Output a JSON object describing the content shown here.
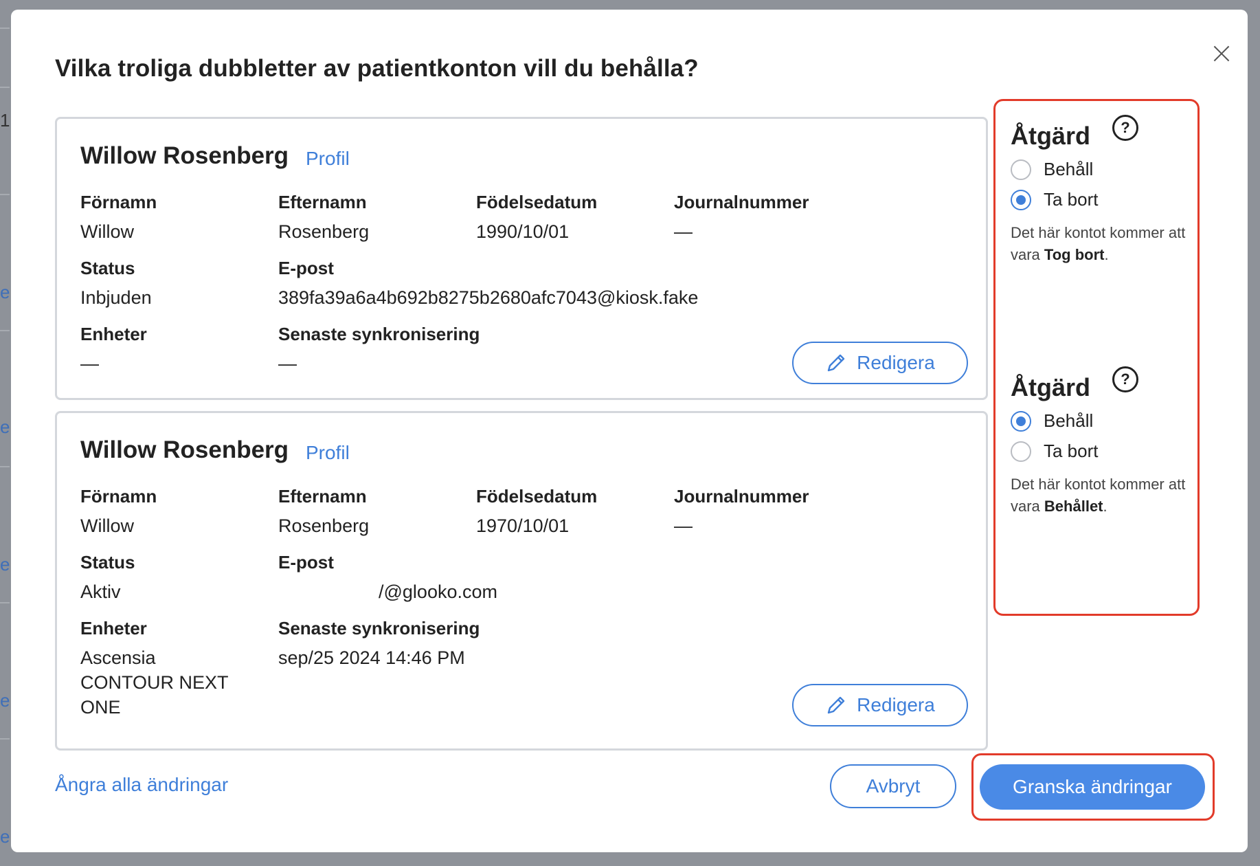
{
  "background": {
    "glyph_1": "1",
    "glyph_2": "e"
  },
  "modal": {
    "title": "Vilka troliga dubbletter av patientkonton vill du behålla?",
    "close_label": "×"
  },
  "labels": {
    "first_name": "Förnamn",
    "last_name": "Efternamn",
    "birth_date": "Födelsedatum",
    "record_number": "Journalnummer",
    "status": "Status",
    "email": "E-post",
    "devices": "Enheter",
    "last_sync": "Senaste synkronisering",
    "profile_link": "Profil",
    "edit_button": "Redigera"
  },
  "accounts": [
    {
      "name": "Willow Rosenberg",
      "first_name": "Willow",
      "last_name": "Rosenberg",
      "birth_date": "1990/10/01",
      "record_number": "—",
      "status": "Inbjuden",
      "email": "389fa39a6a4b692b8275b2680afc7043@kiosk.fake",
      "devices": [
        "—"
      ],
      "last_sync": "—"
    },
    {
      "name": "Willow Rosenberg",
      "first_name": "Willow",
      "last_name": "Rosenberg",
      "birth_date": "1970/10/01",
      "record_number": "—",
      "status": "Aktiv",
      "email_visible": "/@glooko.com",
      "devices": [
        "Ascensia",
        "CONTOUR NEXT",
        "ONE"
      ],
      "last_sync": "sep/25 2024 14:46 PM"
    }
  ],
  "actions": {
    "title": "Åtgärd",
    "help_icon": "?",
    "keep_label": "Behåll",
    "remove_label": "Ta bort",
    "desc_prefix": "Det här kontot kommer att vara",
    "items": [
      {
        "selected": "Ta bort",
        "result": "Tog bort"
      },
      {
        "selected": "Behåll",
        "result": "Behållet"
      }
    ]
  },
  "footer": {
    "undo_link": "Ångra alla ändringar",
    "cancel_button": "Avbryt",
    "review_button": "Granska ändringar"
  },
  "colors": {
    "accent": "#3f7fd9",
    "primary_button": "#4a8ae6",
    "highlight": "#e23b2a",
    "overlay": "#8e9299"
  }
}
